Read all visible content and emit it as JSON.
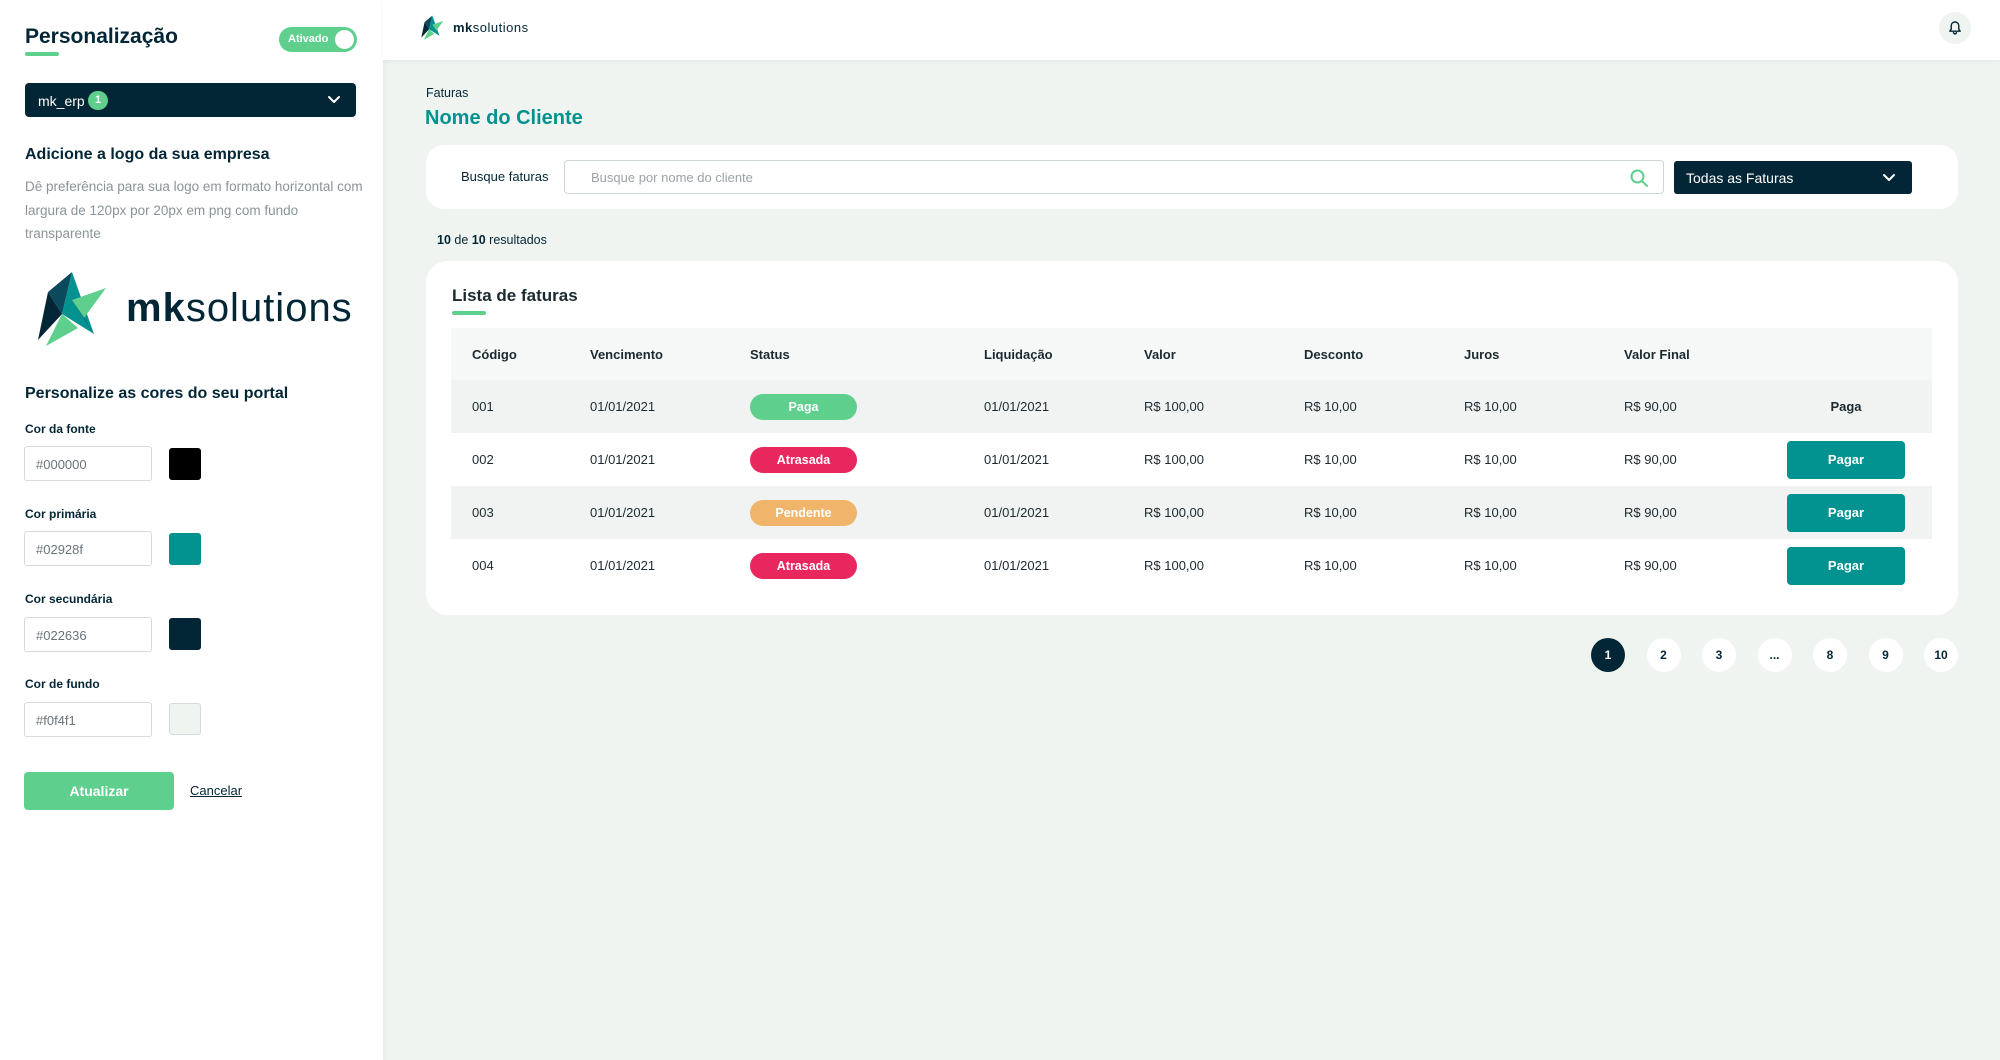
{
  "sidebar": {
    "title": "Personalização",
    "toggle_label": "Ativado",
    "org_select": {
      "value": "mk_erp",
      "badge": "1"
    },
    "logo_heading": "Adicione a logo da sua empresa",
    "logo_help": "Dê preferência para sua logo em formato horizontal com largura de 120px por 20px em png com fundo transparente",
    "logo_text_bold": "mk",
    "logo_text_rest": "solutions",
    "colors_heading": "Personalize as cores do seu portal",
    "colors": [
      {
        "label": "Cor da fonte",
        "value": "#000000",
        "swatch": "#000000"
      },
      {
        "label": "Cor primária",
        "value": "#02928f",
        "swatch": "#02928f"
      },
      {
        "label": "Cor secundária",
        "value": "#022636",
        "swatch": "#022636"
      },
      {
        "label": "Cor de fundo",
        "value": "#f0f4f1",
        "swatch": "#f0f4f1"
      }
    ],
    "update_button": "Atualizar",
    "cancel_link": "Cancelar"
  },
  "topbar": {
    "logo_bold": "mk",
    "logo_rest": "solutions",
    "bell_icon": "bell-icon"
  },
  "main": {
    "breadcrumb": "Faturas",
    "title": "Nome do Cliente",
    "search": {
      "label": "Busque faturas",
      "placeholder": "Busque por nome do cliente",
      "filter_value": "Todas as Faturas"
    },
    "results": {
      "shown": "10",
      "middle": "de",
      "total": "10",
      "suffix": "resultados"
    },
    "list_title": "Lista de faturas",
    "columns": [
      "Código",
      "Vencimento",
      "Status",
      "Liquidação",
      "Valor",
      "Desconto",
      "Juros",
      "Valor Final"
    ],
    "rows": [
      {
        "code": "001",
        "due": "01/01/2021",
        "status": "Paga",
        "status_color": "#5fcf8d",
        "settled": "01/01/2021",
        "value": "R$ 100,00",
        "discount": "R$ 10,00",
        "interest": "R$ 10,00",
        "final": "R$ 90,00",
        "action": "Paga",
        "action_type": "text"
      },
      {
        "code": "002",
        "due": "01/01/2021",
        "status": "Atrasada",
        "status_color": "#e8275f",
        "settled": "01/01/2021",
        "value": "R$ 100,00",
        "discount": "R$ 10,00",
        "interest": "R$ 10,00",
        "final": "R$ 90,00",
        "action": "Pagar",
        "action_type": "button"
      },
      {
        "code": "003",
        "due": "01/01/2021",
        "status": "Pendente",
        "status_color": "#f0b56b",
        "settled": "01/01/2021",
        "value": "R$ 100,00",
        "discount": "R$ 10,00",
        "interest": "R$ 10,00",
        "final": "R$ 90,00",
        "action": "Pagar",
        "action_type": "button"
      },
      {
        "code": "004",
        "due": "01/01/2021",
        "status": "Atrasada",
        "status_color": "#e8275f",
        "settled": "01/01/2021",
        "value": "R$ 100,00",
        "discount": "R$ 10,00",
        "interest": "R$ 10,00",
        "final": "R$ 90,00",
        "action": "Pagar",
        "action_type": "button"
      }
    ],
    "pagination": {
      "pages": [
        "1",
        "2",
        "3",
        "...",
        "8",
        "9",
        "10"
      ],
      "active": "1"
    }
  },
  "colors": {
    "primary": "#02928f",
    "secondary": "#022636",
    "accent_green": "#5fcf8d",
    "background": "#f0f4f1"
  }
}
